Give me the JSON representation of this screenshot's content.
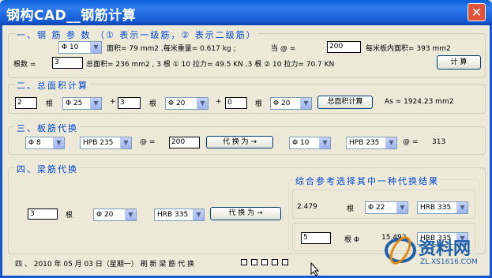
{
  "title": "钢构CAD__钢筋计算",
  "close": "✕",
  "sec1": {
    "title": "一、钢 筋 参 数 （① 表示一级筋，② 表示二级筋）",
    "dia": "Φ 10",
    "area": "面积= 79 mm2 ,每米重量= 0.617 kg ;",
    "at_label": "当 @ =",
    "at_value": "200",
    "per_m": "每米板内面积= 393 mm2",
    "count_label": "根数 =",
    "count_value": "3",
    "total": "总面积= 236 mm2 , 3 根 ① 10 拉力= 49.5 KN ,3 根 ② 10 拉力= 70.7 KN",
    "calc_btn": "计 算"
  },
  "sec2": {
    "title": "二、总面积计算",
    "n1": "2",
    "u1": "根",
    "d1": "Φ 25",
    "p1": "+",
    "n2": "3",
    "u2": "根",
    "d2": "Φ 20",
    "p2": "+",
    "n3": "0",
    "u3": "根",
    "d3": "Φ 20",
    "btn": "总面积计算",
    "as": "As =  1924.23 mm2"
  },
  "sec3": {
    "title": "三、板筋代换",
    "d1": "Φ 8",
    "g1": "HPB 235",
    "at": "@ =",
    "v1": "200",
    "btn": "代 换 为 →",
    "d2": "Φ 10",
    "g2": "HPB 235",
    "at2": "@ =",
    "v2": "313"
  },
  "sec4": {
    "title": "四、梁筋代换",
    "n": "3",
    "u": "根",
    "d": "Φ 20",
    "g": "HRB 335",
    "btn": "代 换 为 →",
    "result_title": "综合参考选择其中一种代换结果",
    "r1_val": "2.479",
    "r1_u": "根",
    "r1_d": "Φ 22",
    "r1_g": "HRB 335",
    "r2_n": "5",
    "r2_u": "根 Φ",
    "r2_val": "15.492",
    "r2_g": "HRB 335"
  },
  "status": {
    "date": "四 、 2010 年 05 月 03 日（星期一） 刷 新 梁 筋 代 换"
  },
  "watermark": {
    "big": "资料网",
    "small": "ZL.XS1616.COM"
  }
}
